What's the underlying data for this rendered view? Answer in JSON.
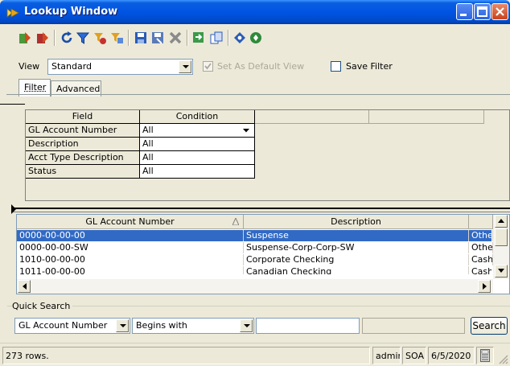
{
  "window": {
    "title": "Lookup Window"
  },
  "toolbar": {
    "icons": [
      "add-record-icon",
      "delete-record-icon",
      "refresh-icon",
      "filter-icon",
      "clear-filter-icon",
      "filter-options-icon",
      "save-icon",
      "save-as-icon",
      "cancel-icon",
      "export-icon",
      "copy-icon",
      "previous-icon",
      "help-icon"
    ]
  },
  "view": {
    "label": "View",
    "selected": "Standard",
    "set_default_label": "Set As Default View",
    "set_default_checked": true,
    "save_filter_label": "Save Filter",
    "save_filter_checked": false
  },
  "tabs": [
    {
      "label": "Filter",
      "active": true
    },
    {
      "label": "Advanced",
      "active": false
    }
  ],
  "filter": {
    "headers": [
      "Field",
      "Condition"
    ],
    "rows": [
      {
        "field": "GL Account Number",
        "condition": "All"
      },
      {
        "field": "Description",
        "condition": "All"
      },
      {
        "field": "Acct Type Description",
        "condition": "All"
      },
      {
        "field": "Status",
        "condition": "All"
      }
    ]
  },
  "grid": {
    "headers": [
      "GL Account Number",
      "Description"
    ],
    "rows": [
      {
        "account": "0000-00-00-00",
        "description": "Suspense",
        "extra": "Other"
      },
      {
        "account": "0000-00-00-SW",
        "description": "Suspense-Corp-Corp-SW",
        "extra": "Other"
      },
      {
        "account": "1010-00-00-00",
        "description": "Corporate Checking",
        "extra": "Cash"
      },
      {
        "account": "1011-00-00-00",
        "description": "Canadian Checking",
        "extra": "Cash"
      }
    ],
    "selected_row": 0
  },
  "quick_search": {
    "label": "Quick Search",
    "field": "GL Account Number",
    "operator": "Begins with",
    "value": "",
    "search_label": "Search"
  },
  "status": {
    "rows": "273 rows.",
    "user": "admin",
    "company": "SOA",
    "date": "6/5/2020"
  },
  "colors": {
    "title_bar": "#0054e3",
    "selection": "#316ac5",
    "window_bg": "#ece9d8"
  }
}
